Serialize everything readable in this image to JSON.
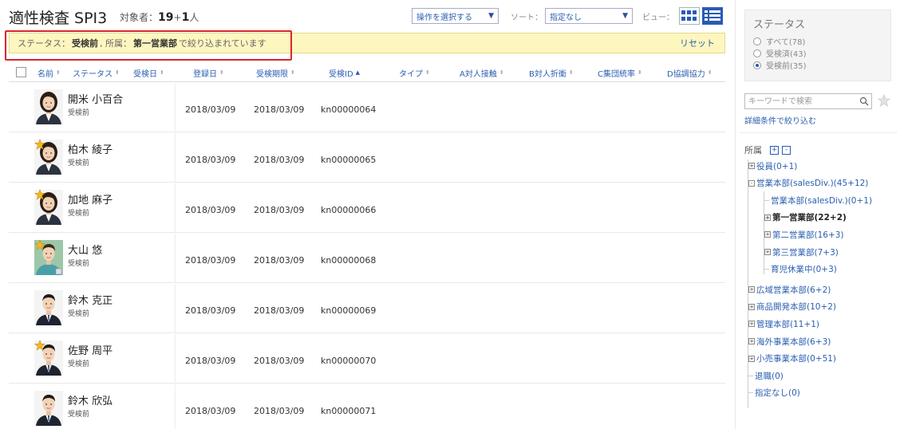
{
  "header": {
    "title": "適性検査 SPI3",
    "target_label": "対象者：",
    "count_main": "19",
    "count_plus": "+",
    "count_extra": "1",
    "count_unit": "人"
  },
  "toolbar": {
    "action_select": "操作を選択する",
    "sort_label": "ソート：",
    "sort_value": "指定なし",
    "view_label": "ビュー："
  },
  "filter": {
    "prefix": "ステータス：",
    "status": "受検前",
    "sep": ", 所属：",
    "dept": "第一営業部",
    "suffix": "で絞り込まれています",
    "reset": "リセット"
  },
  "columns": [
    "名前",
    "ステータス",
    "受検日",
    "登録日",
    "受検期限",
    "受検ID",
    "タイプ",
    "A対人接触",
    "B対人折衝",
    "C集団統率",
    "D協調協力"
  ],
  "rows": [
    {
      "name": "開米 小百合",
      "status": "受検前",
      "registered": "2018/03/09",
      "deadline": "2018/03/09",
      "id": "kn00000064",
      "star": false,
      "avatar": "female"
    },
    {
      "name": "柏木 綾子",
      "status": "受検前",
      "registered": "2018/03/09",
      "deadline": "2018/03/09",
      "id": "kn00000065",
      "star": true,
      "avatar": "female"
    },
    {
      "name": "加地 麻子",
      "status": "受検前",
      "registered": "2018/03/09",
      "deadline": "2018/03/09",
      "id": "kn00000066",
      "star": true,
      "avatar": "female"
    },
    {
      "name": "大山 悠",
      "status": "受検前",
      "registered": "2018/03/09",
      "deadline": "2018/03/09",
      "id": "kn00000068",
      "star": true,
      "avatar": "male-casual"
    },
    {
      "name": "鈴木 克正",
      "status": "受検前",
      "registered": "2018/03/09",
      "deadline": "2018/03/09",
      "id": "kn00000069",
      "star": false,
      "avatar": "male"
    },
    {
      "name": "佐野 周平",
      "status": "受検前",
      "registered": "2018/03/09",
      "deadline": "2018/03/09",
      "id": "kn00000070",
      "star": true,
      "avatar": "male"
    },
    {
      "name": "鈴木 欣弘",
      "status": "受検前",
      "registered": "2018/03/09",
      "deadline": "2018/03/09",
      "id": "kn00000071",
      "star": false,
      "avatar": "male"
    }
  ],
  "sidebar": {
    "status_title": "ステータス",
    "status_options": [
      {
        "label": "すべて(78)",
        "checked": false
      },
      {
        "label": "受検済(43)",
        "checked": false
      },
      {
        "label": "受検前(35)",
        "checked": true
      }
    ],
    "search_placeholder": "キーワードで検索",
    "detail_link": "詳細条件で絞り込む",
    "tree_title": "所属",
    "tree": [
      {
        "label": "役員(0+1)",
        "level": 0,
        "toggle": "+"
      },
      {
        "label": "営業本部(salesDiv.)(45+12)",
        "level": 0,
        "toggle": "-"
      },
      {
        "label": "営業本部(salesDiv.)(0+1)",
        "level": 1,
        "toggle": ""
      },
      {
        "label": "第一営業部(22+2)",
        "level": 1,
        "toggle": "+",
        "bold": true
      },
      {
        "label": "第二営業部(16+3)",
        "level": 1,
        "toggle": "+"
      },
      {
        "label": "第三営業部(7+3)",
        "level": 1,
        "toggle": "+"
      },
      {
        "label": "育児休業中(0+3)",
        "level": 1,
        "toggle": ""
      },
      {
        "label": "広域営業本部(6+2)",
        "level": 0,
        "toggle": "+"
      },
      {
        "label": "商品開発本部(10+2)",
        "level": 0,
        "toggle": "+"
      },
      {
        "label": "管理本部(11+1)",
        "level": 0,
        "toggle": "+"
      },
      {
        "label": "海外事業本部(6+3)",
        "level": 0,
        "toggle": "+"
      },
      {
        "label": "小売事業本部(0+51)",
        "level": 0,
        "toggle": "+"
      },
      {
        "label": "退職(0)",
        "level": 0,
        "toggle": ""
      },
      {
        "label": "指定なし(0)",
        "level": 0,
        "toggle": ""
      }
    ]
  },
  "colors": {
    "accent": "#2a5bb5",
    "link": "#2b5fb0",
    "filter_bg": "#fdf6bf",
    "highlight": "#d9262b",
    "star": "#f3b81f"
  }
}
